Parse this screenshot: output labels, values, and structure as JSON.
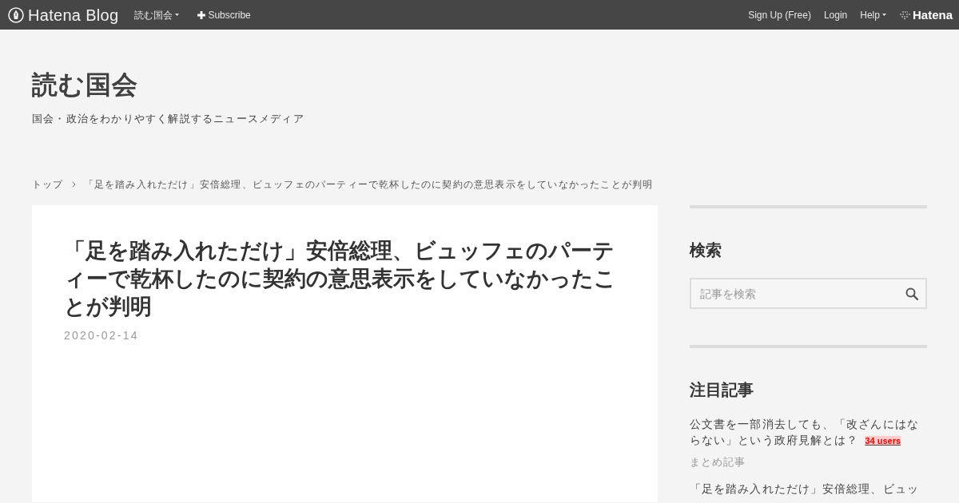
{
  "top_bar": {
    "logo": {
      "text": "Hatena Blog"
    },
    "nav_left": [
      {
        "label": "読む国会",
        "kind": "dropdown"
      },
      {
        "label": "Subscribe",
        "kind": "subscribe"
      }
    ],
    "nav_right": [
      {
        "label": "Sign Up (Free)",
        "kind": "link"
      },
      {
        "label": "Login",
        "kind": "link"
      },
      {
        "label": "Help",
        "kind": "dropdown"
      }
    ],
    "brand": {
      "text": "Hatena"
    }
  },
  "header": {
    "title": "読む国会",
    "tagline": "国会・政治をわかりやすく解説するニュースメディア"
  },
  "breadcrumb": [
    "トップ",
    "「足を踏み入れただけ」安倍総理、ビュッフェのパーティーで乾杯したのに契約の意思表示をしていなかったことが判明"
  ],
  "article": {
    "title": "「足を踏み入れただけ」安倍総理、ビュッフェのパーティーで乾杯したのに契約の意思表示をしていなかったことが判明",
    "date": "2020-02-14"
  },
  "sidebar": {
    "modules": [
      {
        "kind": "search",
        "title": "検索",
        "placeholder": "記事を検索"
      },
      {
        "kind": "entries",
        "title": "注目記事",
        "entries": [
          {
            "title": "公文書を一部消去しても、「改ざんにはならない」という政府見解とは？",
            "bookmarks": "34 users",
            "category": "まとめ記事"
          },
          {
            "title": "「足を踏み入れただけ」安倍総理、ビュッ"
          }
        ]
      }
    ]
  }
}
